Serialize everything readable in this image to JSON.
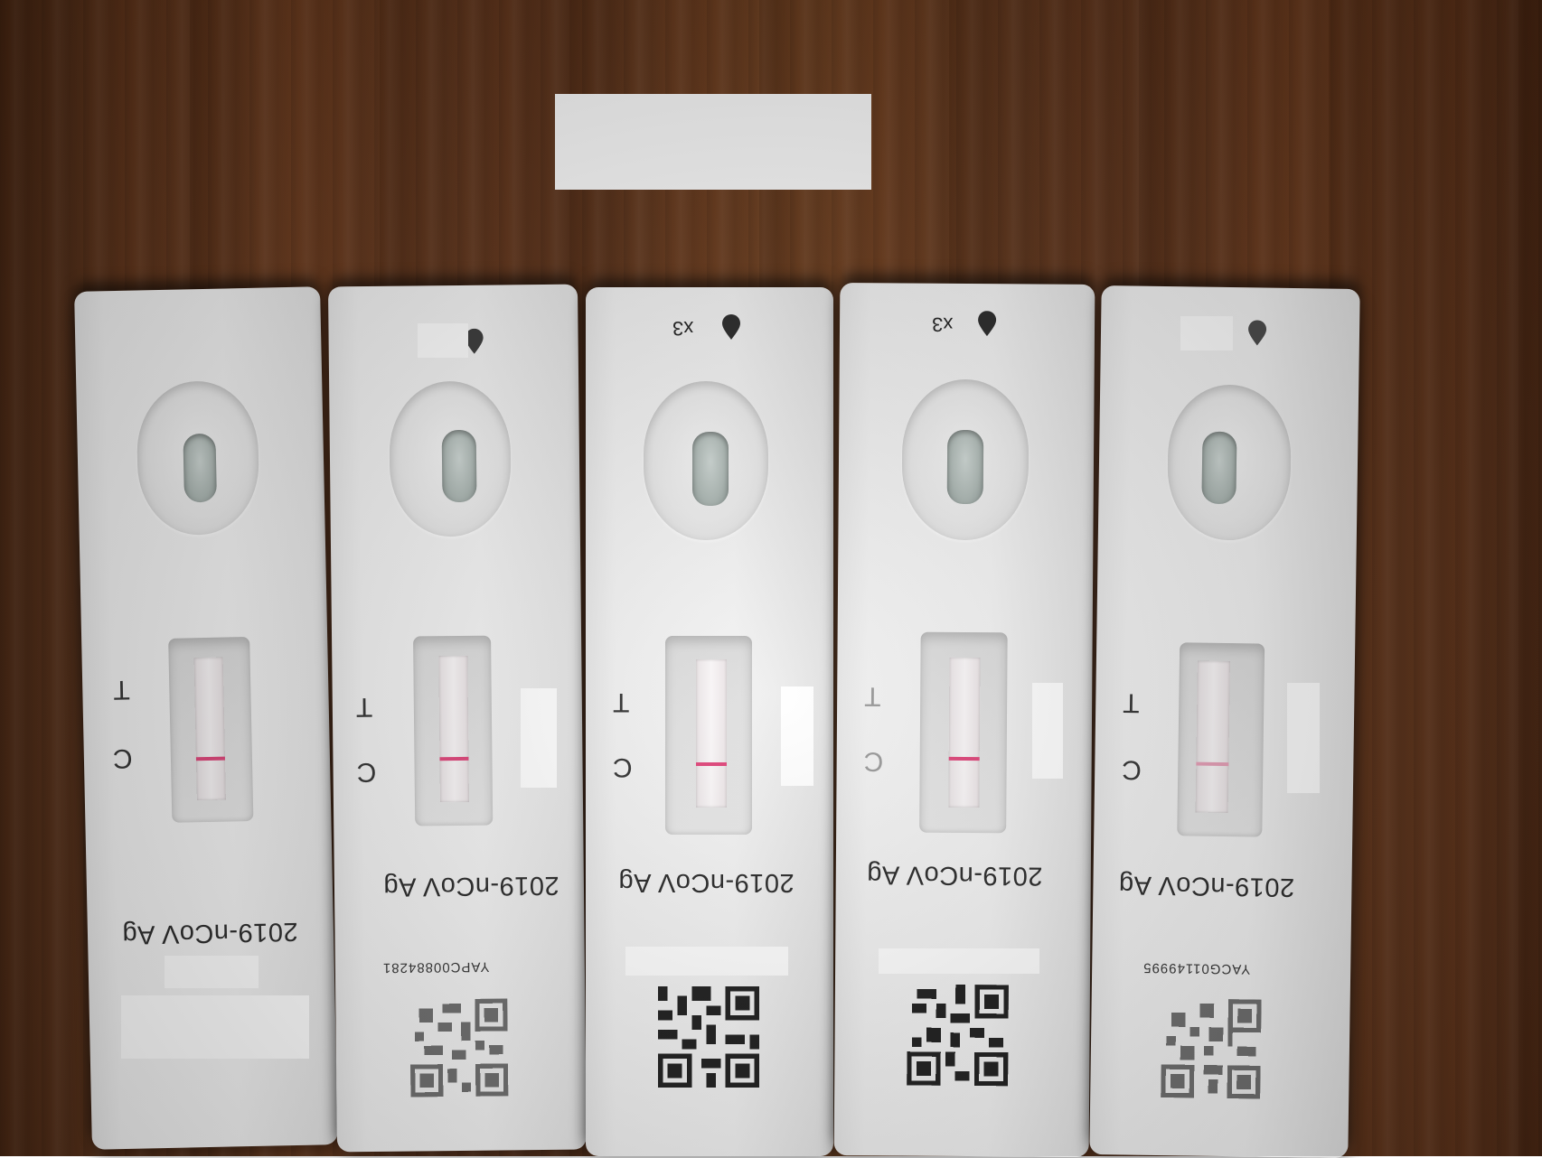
{
  "photo": {
    "subject": "five rapid antigen test cassettes on wooden surface",
    "background_color": "#5e341b",
    "cassette_color": "#f1f1f1",
    "control_line_color": "#e0457a"
  },
  "cassettes": [
    {
      "product": "2019-nCoV Ag",
      "mark_c": "C",
      "mark_t": "T",
      "drops": "",
      "serial": "",
      "has_qr": false,
      "drop_icon": "none"
    },
    {
      "product": "2019-nCoV Ag",
      "mark_c": "C",
      "mark_t": "T",
      "drops": "",
      "serial": "YAPC00884281",
      "has_qr": true,
      "drop_icon": "drop-icon"
    },
    {
      "product": "2019-nCoV Ag",
      "mark_c": "C",
      "mark_t": "T",
      "drops": "x3",
      "serial": "",
      "has_qr": true,
      "drop_icon": "drop-icon"
    },
    {
      "product": "2019-nCoV Ag",
      "mark_c": "C",
      "mark_t": "T",
      "drops": "x3",
      "serial": "",
      "has_qr": true,
      "drop_icon": "drop-icon"
    },
    {
      "product": "2019-nCoV Ag",
      "mark_c": "C",
      "mark_t": "T",
      "drops": "",
      "serial": "YACG01149995",
      "has_qr": true,
      "drop_icon": "drop-icon"
    }
  ]
}
